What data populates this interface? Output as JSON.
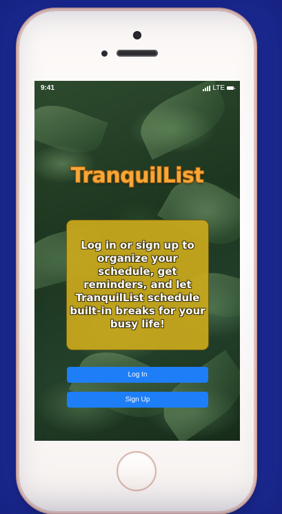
{
  "status_bar": {
    "time": "9:41",
    "network": "LTE",
    "icons": [
      "signal-icon",
      "battery-icon"
    ]
  },
  "app": {
    "title": "TranquilList",
    "description": "Log in or sign up to organize your schedule, get reminders, and let TranquilList schedule built-in breaks for your busy life!",
    "login_label": "Log In",
    "signup_label": "Sign Up"
  },
  "colors": {
    "page_background": "#1c2a94",
    "title": "#f9a637",
    "card": "#c9a81c",
    "button": "#1e7ef7",
    "phone_frame": "#e9c9c0"
  }
}
